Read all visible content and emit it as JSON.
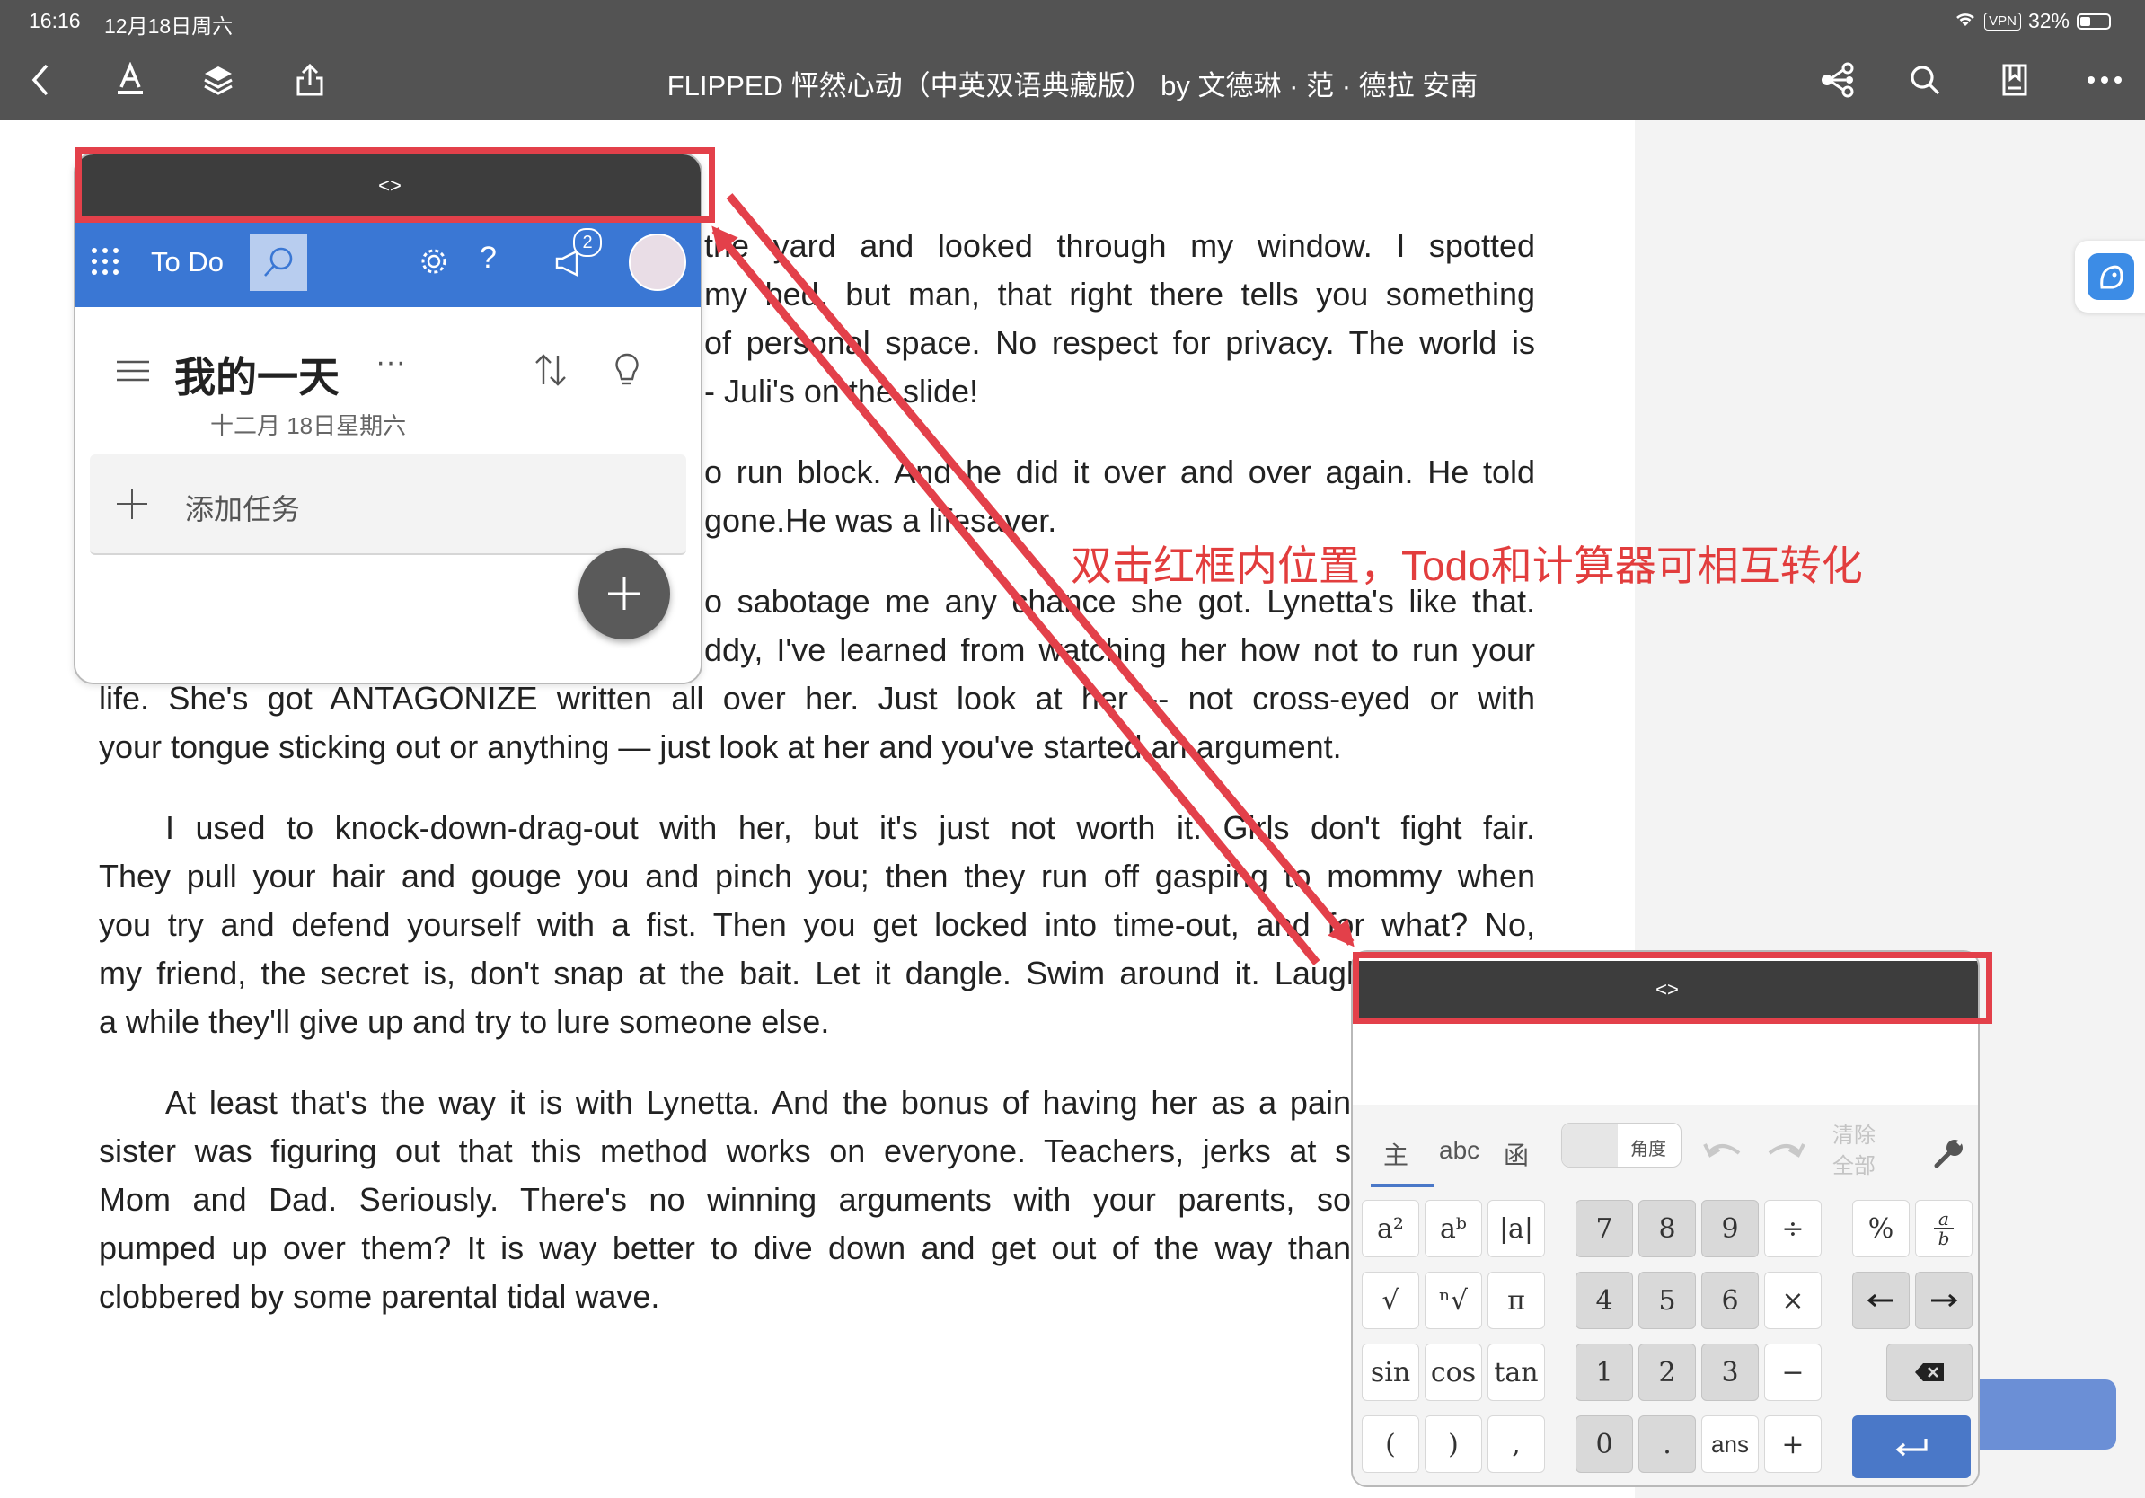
{
  "status": {
    "time": "16:16",
    "date": "12月18日周六",
    "vpn": "VPN",
    "battery": "32%"
  },
  "toolbar": {
    "title": "FLIPPED 怦然心动（中英双语典藏版） by 文德琳 · 范 · 德拉  安南"
  },
  "book": {
    "lines": [
      "the yard and looked through my window. I spotted",
      "my bed, but man, that right there tells you something",
      "of personal space. No respect for privacy. The world is",
      "- Juli's on the slide!",
      "o run block. And he did it over and over again. He told",
      "gone.He was a lifesaver.",
      "o sabotage me any chance she got. Lynetta's like that.",
      "ddy, I've learned from watching her how not to run your",
      "life. She's got ANTAGONIZE written all over her. Just look at her -- not cross-eyed or with",
      "your tongue sticking out or anything — just look at her and you've started an argument.",
      "I used to knock-down-drag-out with her, but it's just not worth it. Girls don't fight fair.",
      "They pull your hair and gouge you and pinch you; then they run off gasping to mommy when",
      "you try and defend yourself with a fist. Then you get locked into time-out, and for what? No,",
      "my friend, the secret is, don't snap at the bait. Let it dangle. Swim around it. Laugh it off. After",
      "a while they'll give up and try to lure someone else.",
      "At least that's the way it is with Lynetta. And the bonus of having her as a pain",
      "sister was figuring out that this method works on everyone. Teachers, jerks at s",
      "Mom and Dad. Seriously. There's no winning arguments with your parents, so",
      "pumped up over them? It is way better to dive down and get out of the way than",
      "clobbered by some parental tidal wave."
    ]
  },
  "annotation": "双击红框内位置，Todo和计算器可相互转化",
  "todo": {
    "handle": "<>",
    "app_name": "To Do",
    "badge": "2",
    "list_title": "我的一天",
    "more": "···",
    "date": "十二月 18日星期六",
    "add_task": "添加任务"
  },
  "calc": {
    "handle": "<>",
    "tabs": [
      "主",
      "abc",
      "函"
    ],
    "mode": "角度",
    "clear_all": "清除全部",
    "keys": {
      "sq": "a²",
      "pow": "aᵇ",
      "abs": "|a|",
      "sqrt": "√",
      "nroot": "ⁿ√",
      "pi": "π",
      "sin": "sin",
      "cos": "cos",
      "tan": "tan",
      "lp": "(",
      "rp": ")",
      "comma": ",",
      "n7": "7",
      "n8": "8",
      "n9": "9",
      "div": "÷",
      "n4": "4",
      "n5": "5",
      "n6": "6",
      "mul": "×",
      "n1": "1",
      "n2": "2",
      "n3": "3",
      "minus": "−",
      "n0": "0",
      "dot": ".",
      "ans": "ans",
      "plus": "+",
      "pct": "%",
      "frac_a": "a",
      "frac_b": "b"
    }
  },
  "colors": {
    "accent_red": "#e3404a",
    "todo_blue": "#3a77d4",
    "calc_enter": "#4a78c8"
  }
}
